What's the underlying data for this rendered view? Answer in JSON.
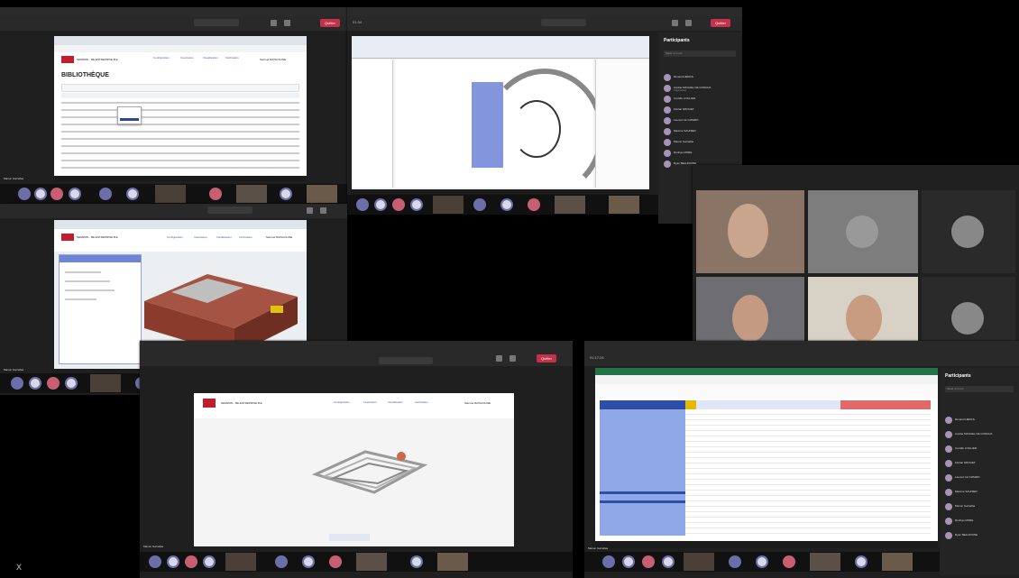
{
  "windows": {
    "top_left": {
      "titlebar": "",
      "app_title": "BIBLIOTHÈQUE",
      "company": "NEMROD · BE ENTREPRISE B.E",
      "user": "Samuel RAISCOLINE",
      "nav": [
        "Configuration",
        "Inventaires",
        "Visualisation",
        "Vérification"
      ],
      "participant_label": "Manon Garrellas"
    },
    "top_center": {
      "titlebar": "",
      "timer": "01:34",
      "quit_label": "Quitter"
    },
    "mid_left": {
      "timer": "",
      "company": "NEMROD · BE ENTREPRISE B.E",
      "user": "Samuel RAISCOLINE",
      "nav": [
        "Configuration",
        "Inventaires",
        "Visualisation",
        "Vérification"
      ],
      "participant_label": "Manon Garrellas"
    },
    "bottom_center": {
      "timer": "",
      "quit_label": "Quitter",
      "company": "NEMROD · BE ENTREPRISE B.E",
      "user": "Samuel RAISCOLINE",
      "nav": [
        "Configuration",
        "Inventaires",
        "Visualisation",
        "Vérification"
      ],
      "participant_label": "Manon Garrellas"
    },
    "bottom_right": {
      "timer": "01:17:24",
      "participant_label": "Manon Garrellas"
    }
  },
  "participants_panel": {
    "title": "Participants",
    "search_placeholder": "Taper un nom",
    "items": [
      {
        "name": "Renaud HERCIL",
        "sub": ""
      },
      {
        "name": "Aurélie MANUEL DE CONCHA",
        "sub": "Organisateur"
      },
      {
        "name": "Camille LOILLIER",
        "sub": ""
      },
      {
        "name": "Florian DROUET",
        "sub": ""
      },
      {
        "name": "Laurent LE GOMMO",
        "sub": ""
      },
      {
        "name": "Maxime SAUNIER",
        "sub": ""
      },
      {
        "name": "Manon Garrellas",
        "sub": ""
      },
      {
        "name": "Rodrigo MORE",
        "sub": ""
      },
      {
        "name": "Ryan BELHOCINE",
        "sub": ""
      }
    ]
  },
  "corner_label": "X",
  "colors": {
    "teams_red": "#c4314b",
    "avatar_purple": "#6b6ea8",
    "brick": "#8a3b2c",
    "excel_green": "#217346",
    "revit_blue": "#6d83d6"
  }
}
